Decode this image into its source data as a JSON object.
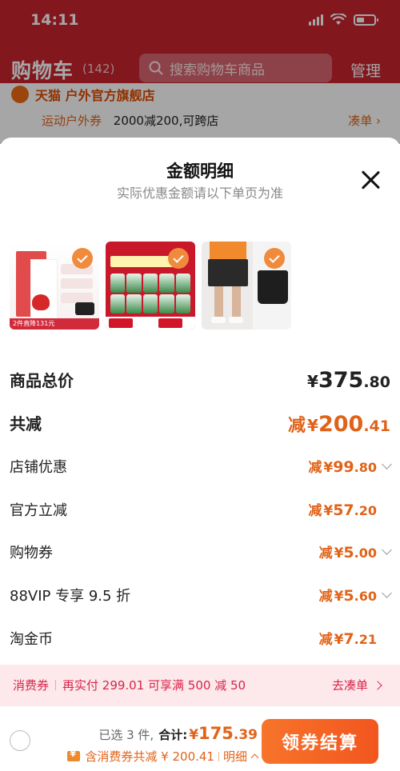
{
  "status_bar": {
    "time": "14:11"
  },
  "header": {
    "title": "购物车",
    "count": "(142)",
    "search_placeholder": "搜索购物车商品",
    "manage_label": "管理",
    "bg_color": "#c8242f"
  },
  "background_store": {
    "store_name": "天猫 户外官方旗舰店",
    "promo_tag": "运动户外券",
    "promo_text": "2000减200,可跨店",
    "link_label": "凑单"
  },
  "sheet": {
    "title": "金额明细",
    "subtitle": "实际优惠金额请以下单页为准",
    "thumbnails": [
      {
        "name": "coenzyme-q10-supplement",
        "strip_text": "2件直降131元"
      },
      {
        "name": "harbin-beer-cans",
        "left_tag": "5",
        "right_tag": "30"
      },
      {
        "name": "black-sports-shorts"
      }
    ],
    "rows": [
      {
        "label": "商品总价",
        "prefix": "",
        "yen": "¥",
        "int": "375",
        "dec": ".80",
        "chevron": false
      },
      {
        "label": "共减",
        "prefix": "减",
        "yen": "¥",
        "int": "200",
        "dec": ".41",
        "chevron": false
      },
      {
        "label": "店铺优惠",
        "prefix": "减",
        "yen": "¥",
        "int": "99",
        "dec": ".80",
        "chevron": true
      },
      {
        "label": "官方立减",
        "prefix": "减",
        "yen": "¥",
        "int": "57",
        "dec": ".20",
        "chevron": false
      },
      {
        "label": "购物券",
        "prefix": "减",
        "yen": "¥",
        "int": "5",
        "dec": ".00",
        "chevron": true
      },
      {
        "label": "88VIP 专享 9.5 折",
        "prefix": "减",
        "yen": "¥",
        "int": "5",
        "dec": ".60",
        "chevron": true
      },
      {
        "label": "淘金币",
        "prefix": "减",
        "yen": "¥",
        "int": "7",
        "dec": ".21",
        "chevron": false
      }
    ]
  },
  "promo_bar": {
    "tag": "消费券",
    "text": "再实付 299.01 可享满 500 减 50",
    "link_label": "去凑单"
  },
  "footer": {
    "selected_text": "已选 3 件,",
    "sum_label": "合计:",
    "total_yen": "¥",
    "total_int": "175",
    "total_dec": ".39",
    "discount_text": "含消费券共减 ¥ 200.41",
    "detail_label": "明细",
    "checkout_label": "领券结算"
  },
  "colors": {
    "accent": "#e0631a",
    "checkout_start": "#f7742a",
    "checkout_end": "#f2561f",
    "promo_bg": "#fde9eb",
    "promo_text": "#d8244a"
  }
}
